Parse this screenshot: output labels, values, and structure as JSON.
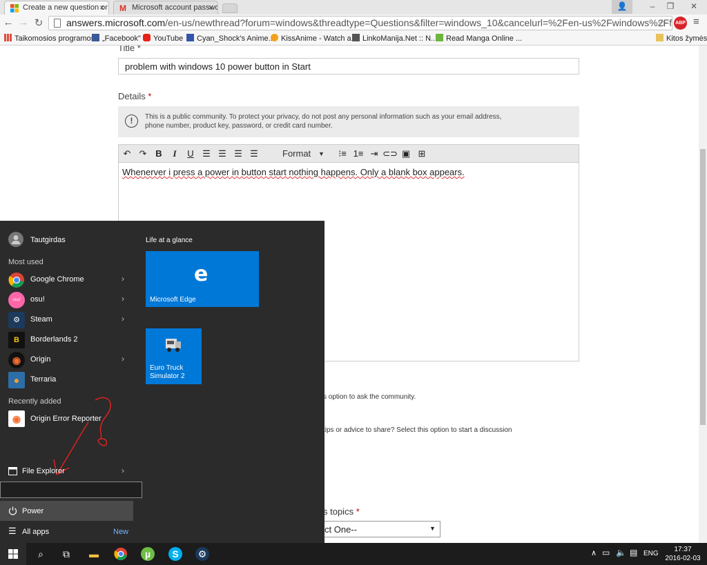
{
  "browser": {
    "tabs": [
      {
        "title": "Create a new question or :",
        "active": true
      },
      {
        "title": "Microsoft account passwo",
        "active": false
      }
    ],
    "url_domain": "answers.microsoft.com",
    "url_path": "/en-us/newthread?forum=windows&threadtype=Questions&filter=windows_10&cancelurl=%2Fen-us%2Fwindows%2Fforum%",
    "abp_label": "ABP",
    "bookmarks": [
      {
        "label": "Taikomosios programos",
        "icon": "apps-grid-icon"
      },
      {
        "label": "„Facebook\"",
        "icon": "facebook-icon"
      },
      {
        "label": "YouTube",
        "icon": "youtube-icon"
      },
      {
        "label": "Cyan_Shock's Anime...",
        "icon": "bookmark-icon"
      },
      {
        "label": "KissAnime - Watch a...",
        "icon": "kissanime-icon"
      },
      {
        "label": "LinkoManija.Net :: N...",
        "icon": "bookmark-icon"
      },
      {
        "label": "Read Manga Online ...",
        "icon": "manga-icon"
      }
    ],
    "other_bookmarks": "Kitos žymės"
  },
  "form": {
    "title_label": "Title *",
    "title_value": "problem with windows 10 power button in Start",
    "details_label": "Details",
    "required_star": "*",
    "notice_line1": "This is a public community. To protect your privacy, do not post any personal information such as your email address,",
    "notice_line2": "phone number, product key, password, or credit card number.",
    "format_label": "Format",
    "body_text": "Whenerver i press a power in button start nothing happens. Only a blank box appears.",
    "question_hint": "s option to ask the community.",
    "discussion_hint": "tips or advice to share? Select this option to start a discussion",
    "topics_label": "s topics",
    "select_value": "ct One--"
  },
  "start_menu": {
    "user": "Tautgirdas",
    "most_used_label": "Most used",
    "apps": [
      {
        "name": "Google Chrome",
        "color": "#ffffff",
        "has_arrow": true
      },
      {
        "name": "osu!",
        "color": "#ff66aa",
        "has_arrow": true
      },
      {
        "name": "Steam",
        "color": "#1b2838",
        "has_arrow": true
      },
      {
        "name": "Borderlands 2",
        "color": "#111111",
        "has_arrow": false
      },
      {
        "name": "Origin",
        "color": "#f56c2d",
        "has_arrow": true
      },
      {
        "name": "Terraria",
        "color": "#2d6ea8",
        "has_arrow": false
      }
    ],
    "recently_added_label": "Recently added",
    "recent_apps": [
      {
        "name": "Origin Error Reporter",
        "color": "#f56c2d"
      }
    ],
    "file_explorer": "File Explorer",
    "power": "Power",
    "all_apps": "All apps",
    "new_badge": "New",
    "group_title": "Life at a glance",
    "tiles": [
      {
        "name": "Microsoft Edge",
        "glyph": "e"
      },
      {
        "name": "Euro Truck Simulator 2",
        "line1": "Euro Truck",
        "line2": "Simulator 2"
      }
    ],
    "annotation": "?"
  },
  "taskbar": {
    "lang": "ENG",
    "time": "17:37",
    "date": "2016-02-03"
  },
  "colors": {
    "accent": "#0078d7",
    "start_bg": "#2b2b2b",
    "taskbar_bg": "#1c1c1c",
    "required": "#c00000",
    "annotation_red": "#e02020"
  }
}
